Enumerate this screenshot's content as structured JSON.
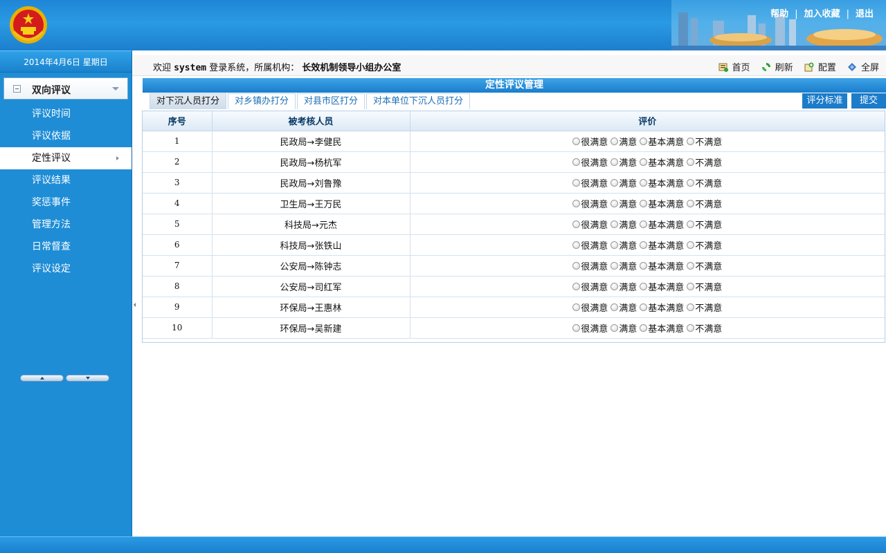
{
  "header": {
    "links": [
      "帮助",
      "加入收藏",
      "退出"
    ]
  },
  "sidebar": {
    "date": "2014年4月6日  星期日",
    "menu_title": "双向评议",
    "items": [
      {
        "label": "评议时间",
        "active": false
      },
      {
        "label": "评议依据",
        "active": false
      },
      {
        "label": "定性评议",
        "active": true
      },
      {
        "label": "评议结果",
        "active": false
      },
      {
        "label": "奖惩事件",
        "active": false
      },
      {
        "label": "管理方法",
        "active": false
      },
      {
        "label": "日常督查",
        "active": false
      },
      {
        "label": "评议设定",
        "active": false
      }
    ]
  },
  "welcome": {
    "prefix": "欢迎",
    "user": "system",
    "middle": "登录系统，所属机构：",
    "org": "长效机制领导小组办公室"
  },
  "toolbar": {
    "home": "首页",
    "refresh": "刷新",
    "config": "配置",
    "fullscreen": "全屏"
  },
  "panel": {
    "title": "定性评议管理",
    "tabs": [
      {
        "label": "对下沉人员打分",
        "active": true
      },
      {
        "label": "对乡镇办打分",
        "active": false
      },
      {
        "label": "对县市区打分",
        "active": false
      },
      {
        "label": "对本单位下沉人员打分",
        "active": false
      }
    ],
    "btn_standard": "评分标准",
    "btn_submit": "提交"
  },
  "table": {
    "columns": [
      "序号",
      "被考核人员",
      "评价"
    ],
    "options": [
      "很满意",
      "满意",
      "基本满意",
      "不满意"
    ],
    "rows": [
      {
        "seq": "1",
        "person": "民政局→李健民"
      },
      {
        "seq": "2",
        "person": "民政局→杨杭军"
      },
      {
        "seq": "3",
        "person": "民政局→刘鲁豫"
      },
      {
        "seq": "4",
        "person": "卫生局→王万民"
      },
      {
        "seq": "5",
        "person": "科技局→元杰"
      },
      {
        "seq": "6",
        "person": "科技局→张铁山"
      },
      {
        "seq": "7",
        "person": "公安局→陈钟志"
      },
      {
        "seq": "8",
        "person": "公安局→司红军"
      },
      {
        "seq": "9",
        "person": "环保局→王惠林"
      },
      {
        "seq": "10",
        "person": "环保局→吴新建"
      }
    ]
  }
}
